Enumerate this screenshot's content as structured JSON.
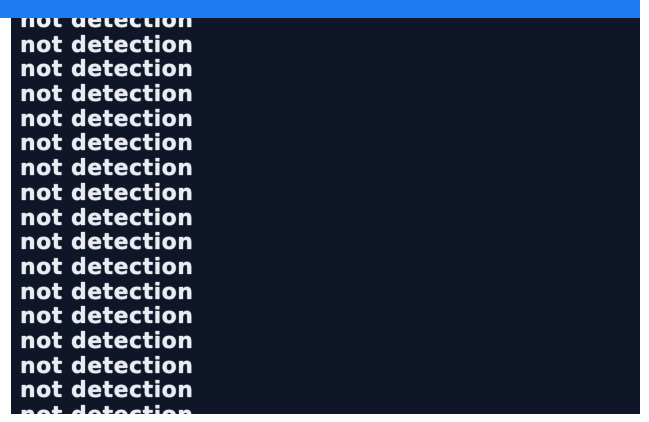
{
  "colors": {
    "console_background": "#0f1628",
    "console_text": "#e9ecf2",
    "selection_bar": "#1e7cf2",
    "frame_background": "#ffffff"
  },
  "console": {
    "lines": [
      "not detection",
      "not detection",
      "not detection",
      "not detection",
      "not detection",
      "not detection",
      "not detection",
      "not detection",
      "not detection",
      "not detection",
      "not detection",
      "not detection",
      "not detection",
      "not detection",
      "not detection",
      "not detection",
      "not detection"
    ]
  }
}
